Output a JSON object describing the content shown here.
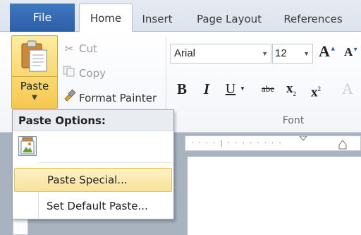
{
  "tabs": {
    "file": "File",
    "home": "Home",
    "insert": "Insert",
    "page_layout": "Page Layout",
    "references": "References"
  },
  "clipboard": {
    "paste": "Paste",
    "cut": "Cut",
    "copy": "Copy",
    "format_painter": "Format Painter"
  },
  "font": {
    "name": "Arial",
    "size": "12",
    "group_label": "Font",
    "bold": "B",
    "italic": "I",
    "underline": "U",
    "strikethrough": "abe",
    "subscript": "x",
    "subscript_mark": "2",
    "superscript": "x",
    "superscript_mark": "2"
  },
  "paste_menu": {
    "header": "Paste Options:",
    "items": [
      {
        "label": "Paste Special...",
        "highlighted": true
      },
      {
        "label": "Set Default Paste...",
        "highlighted": false
      }
    ]
  },
  "icons": {
    "cut": "scissors-icon",
    "copy": "copy-icon",
    "format_painter": "brush-icon",
    "paste": "clipboard-icon",
    "paste_option": "picture-icon"
  },
  "colors": {
    "file_tab": "#2f63ad",
    "highlight": "#f9e29b",
    "paste_button": "#f6c94e"
  }
}
